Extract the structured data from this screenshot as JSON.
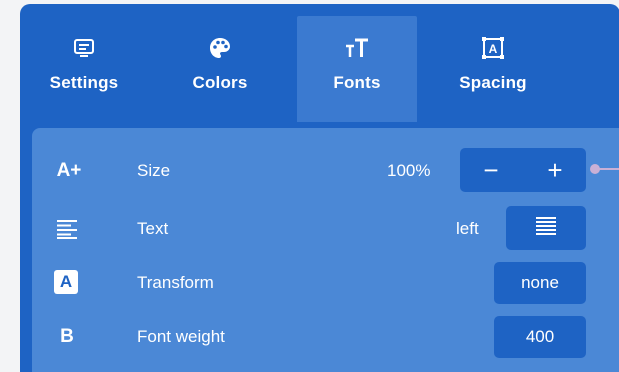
{
  "tabs": [
    {
      "label": "Settings",
      "icon": "settings-icon",
      "active": false
    },
    {
      "label": "Colors",
      "icon": "palette-icon",
      "active": false
    },
    {
      "label": "Fonts",
      "icon": "font-size-icon",
      "active": true
    },
    {
      "label": "Spacing",
      "icon": "spacing-icon",
      "active": false
    }
  ],
  "rows": {
    "size": {
      "icon_text": "A+",
      "label": "Size",
      "value": "100%",
      "decrease": "−",
      "increase": "+"
    },
    "text": {
      "label": "Text",
      "value": "left"
    },
    "transform": {
      "icon_text": "A",
      "label": "Transform",
      "value": "none"
    },
    "weight": {
      "icon_text": "B",
      "label": "Font weight",
      "value": "400"
    }
  },
  "colors": {
    "panel": "#1e63c4",
    "active_tab": "#3b7ad0",
    "content": "#4b88d6",
    "connector": "#c9b0d6"
  }
}
